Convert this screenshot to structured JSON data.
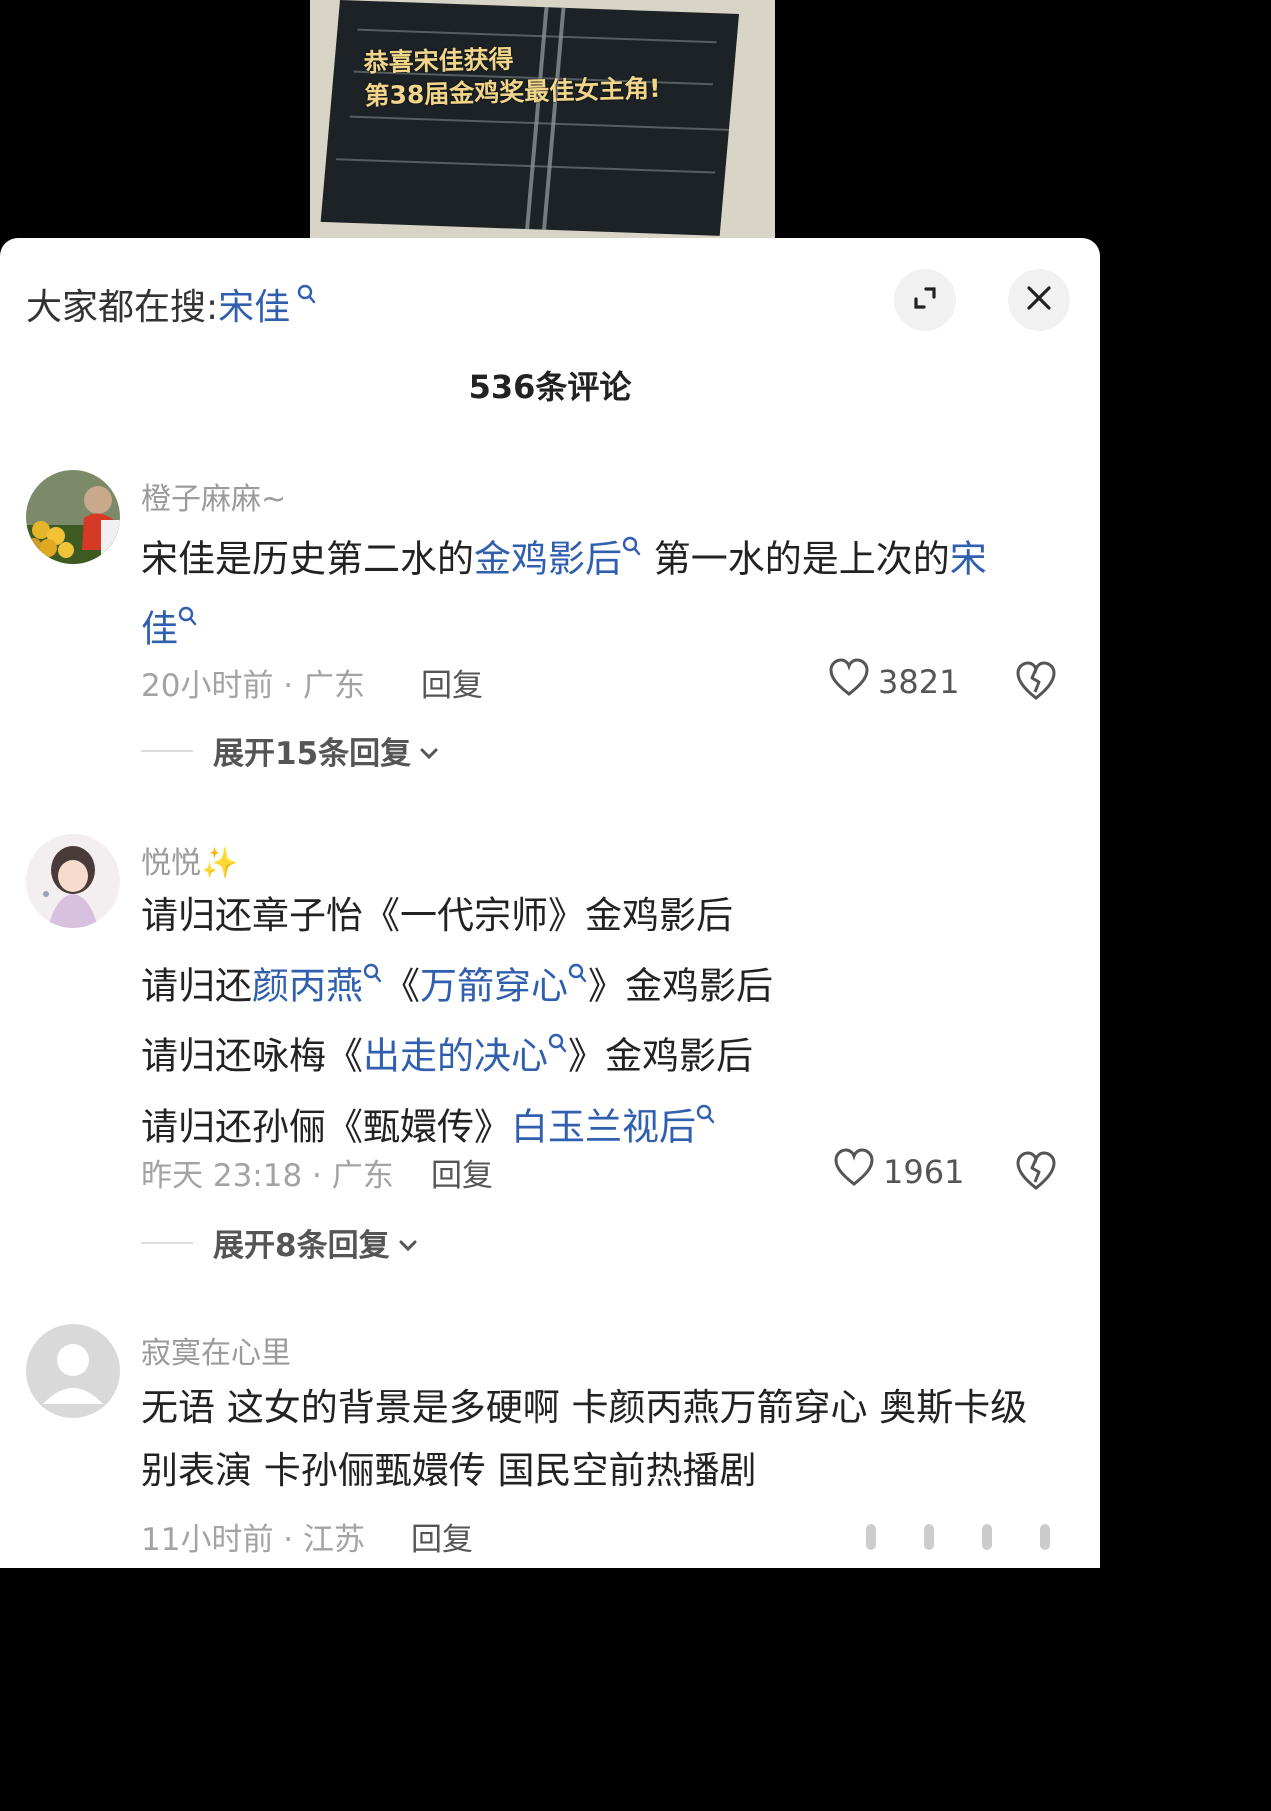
{
  "video": {
    "caption_line1": "恭喜宋佳获得",
    "caption_line2": "第38届金鸡奖最佳女主角!"
  },
  "search": {
    "prefix": "大家都在搜:",
    "keyword": "宋佳",
    "icon": "search-icon"
  },
  "header": {
    "expand_icon": "expand-icon",
    "close_icon": "close-icon",
    "comment_count": "536条评论"
  },
  "comments": [
    {
      "username": "橙子麻麻~",
      "text_line1_a": "宋佳是历史第二水的",
      "text_line1_link": "金鸡影后",
      "text_line1_b": " 第一水的是上次的",
      "text_line1_link2": "宋",
      "text_line2_link": "佳",
      "time_location": "20小时前 · 广东",
      "reply_label": "回复",
      "likes": "3821",
      "expand_label": "展开15条回复"
    },
    {
      "username": "悦悦✨",
      "line1": "请归还章子怡《一代宗师》金鸡影后",
      "line2_a": "请归还",
      "line2_link": "颜丙燕",
      "line2_b": "《",
      "line2_link2": "万箭穿心",
      "line2_c": "》金鸡影后",
      "line3_a": "请归还咏梅《",
      "line3_link": "出走的决心",
      "line3_b": "》金鸡影后",
      "line4_a": "请归还孙俪《甄嬛传》",
      "line4_link": "白玉兰视后",
      "time_location": "昨天 23:18 · 广东",
      "reply_label": "回复",
      "likes": "1961",
      "expand_label": "展开8条回复"
    },
    {
      "username": "寂寞在心里",
      "line1": "无语 这女的背景是多硬啊 卡颜丙燕万箭穿心 奥斯卡级",
      "line2": "别表演 卡孙俪甄嬛传 国民空前热播剧",
      "time_location": "11小时前 · 江苏",
      "reply_label": "回复"
    }
  ]
}
